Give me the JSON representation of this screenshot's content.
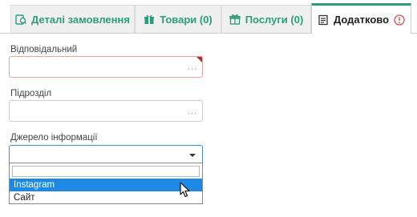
{
  "tabs": [
    {
      "label": "Деталі замовлення",
      "icon": "order-details-icon"
    },
    {
      "label": "Товари (0)",
      "icon": "gift-icon"
    },
    {
      "label": "Послуги (0)",
      "icon": "services-gift-icon"
    },
    {
      "label": "Додатково",
      "icon": "additional-list-icon",
      "badge_icon": "exclamation-circle-icon"
    }
  ],
  "form": {
    "responsible_label": "Відповідальний",
    "responsible_value": "",
    "department_label": "Підрозділ",
    "department_value": "",
    "source_label": "Джерело інформації",
    "source_value": "",
    "browse_dots": "..."
  },
  "dropdown": {
    "search_value": "",
    "options": [
      "Instagram",
      "Сайт"
    ],
    "hovered_option": "Instagram"
  },
  "colors": {
    "accent": "#2a9d7a",
    "focus": "#3a8fd6",
    "highlight": "#1e88e5",
    "required": "#e9a3a3",
    "warning": "#d9534f"
  }
}
